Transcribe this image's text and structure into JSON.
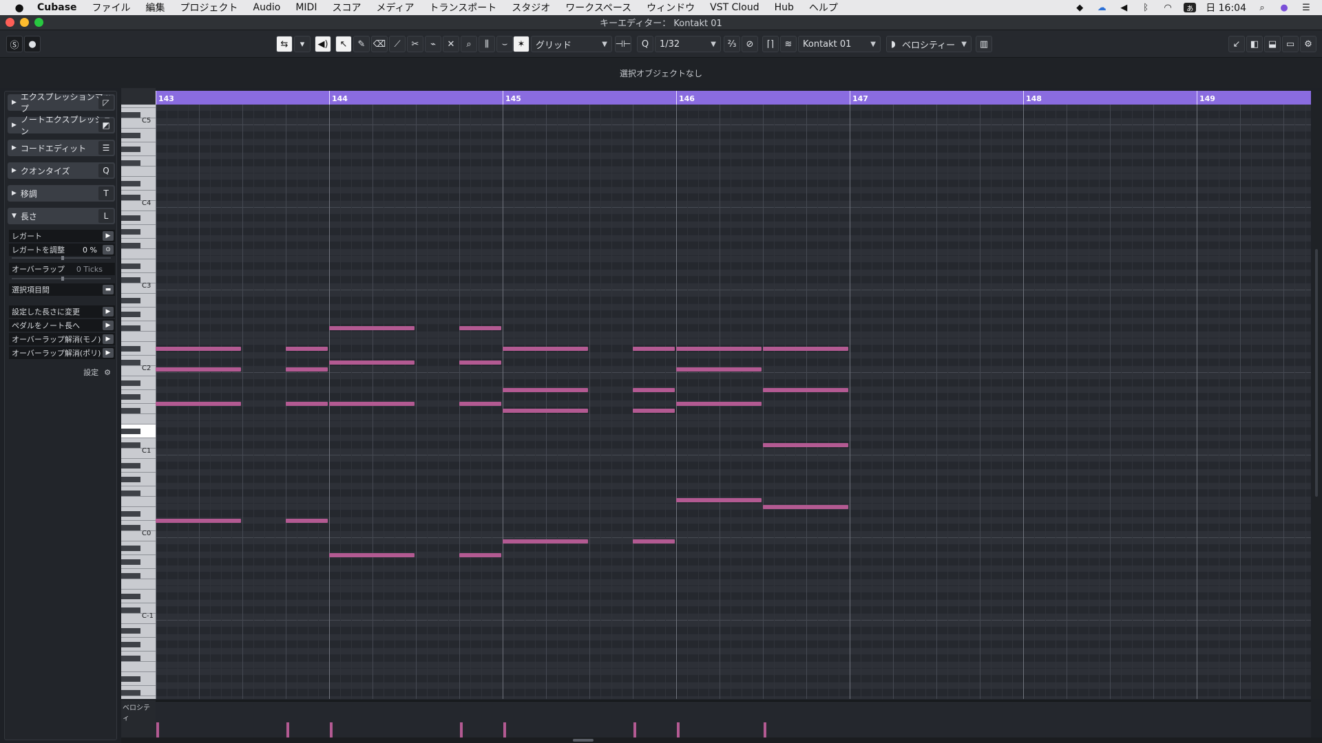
{
  "menubar": {
    "app": "Cubase",
    "items": [
      "ファイル",
      "編集",
      "プロジェクト",
      "Audio",
      "MIDI",
      "スコア",
      "メディア",
      "トランスポート",
      "スタジオ",
      "ワークスペース",
      "ウィンドウ",
      "VST Cloud",
      "Hub",
      "ヘルプ"
    ],
    "clock": "日 16:04"
  },
  "window": {
    "title": "キーエディター： Kontakt 01"
  },
  "toolbar": {
    "snap_type": "グリッド",
    "quantize": "1/32",
    "track": "Kontakt 01",
    "controller": "ベロシティー"
  },
  "infoline": {
    "text": "選択オブジェクトなし"
  },
  "inspector": {
    "sections": [
      {
        "label": "エクスプレッションマップ",
        "icon": "expression-map-icon"
      },
      {
        "label": "ノートエクスプレッション",
        "icon": "note-expression-icon"
      },
      {
        "label": "コードエディット",
        "icon": "chord-edit-icon"
      },
      {
        "label": "クオンタイズ",
        "icon": "quantize-icon",
        "letter": "Q"
      },
      {
        "label": "移調",
        "icon": "transpose-icon",
        "letter": "T"
      },
      {
        "label": "長さ",
        "icon": "length-icon",
        "letter": "L",
        "expanded": true
      }
    ],
    "length": {
      "legato": "レガート",
      "adjust_legato": "レガートを調整",
      "adjust_legato_value": "0 %",
      "overlap": "オーバーラップ",
      "overlap_value": "0 Ticks",
      "between_selected": "選択項目間",
      "fixed_length": "設定した長さに変更",
      "pedal_to_length": "ペダルをノート長へ",
      "delete_overlaps_mono": "オーバーラップ解消(モノ)",
      "delete_overlaps_poly": "オーバーラップ解消(ポリ)"
    },
    "settings_label": "設定"
  },
  "ruler": {
    "bars": [
      "143",
      "144",
      "145",
      "146",
      "147",
      "148",
      "149"
    ]
  },
  "keyboard": {
    "labels": [
      "C5",
      "C4",
      "C3",
      "C2",
      "C1",
      "C0",
      "C-1"
    ]
  },
  "velocity": {
    "label": "ベロシティ"
  },
  "colors": {
    "ruler": "#8a6ce0",
    "note": "#b35a92"
  },
  "notes": [
    {
      "start": 143.0,
      "end": 143.5,
      "pitch": 51
    },
    {
      "start": 143.0,
      "end": 143.5,
      "pitch": 48
    },
    {
      "start": 143.0,
      "end": 143.5,
      "pitch": 43
    },
    {
      "start": 143.0,
      "end": 143.5,
      "pitch": 26
    },
    {
      "start": 143.75,
      "end": 144.0,
      "pitch": 51
    },
    {
      "start": 143.75,
      "end": 144.0,
      "pitch": 48
    },
    {
      "start": 143.75,
      "end": 144.0,
      "pitch": 43
    },
    {
      "start": 143.75,
      "end": 144.0,
      "pitch": 26
    },
    {
      "start": 144.0,
      "end": 144.5,
      "pitch": 54
    },
    {
      "start": 144.0,
      "end": 144.5,
      "pitch": 49
    },
    {
      "start": 144.0,
      "end": 144.5,
      "pitch": 43
    },
    {
      "start": 144.0,
      "end": 144.5,
      "pitch": 21
    },
    {
      "start": 144.75,
      "end": 145.0,
      "pitch": 54
    },
    {
      "start": 144.75,
      "end": 145.0,
      "pitch": 49
    },
    {
      "start": 144.75,
      "end": 145.0,
      "pitch": 43
    },
    {
      "start": 144.75,
      "end": 145.0,
      "pitch": 21
    },
    {
      "start": 145.0,
      "end": 145.5,
      "pitch": 51
    },
    {
      "start": 145.0,
      "end": 145.5,
      "pitch": 45
    },
    {
      "start": 145.0,
      "end": 145.5,
      "pitch": 42
    },
    {
      "start": 145.0,
      "end": 145.5,
      "pitch": 23
    },
    {
      "start": 145.75,
      "end": 146.0,
      "pitch": 51
    },
    {
      "start": 145.75,
      "end": 146.0,
      "pitch": 45
    },
    {
      "start": 145.75,
      "end": 146.0,
      "pitch": 42
    },
    {
      "start": 145.75,
      "end": 146.0,
      "pitch": 23
    },
    {
      "start": 146.0,
      "end": 146.5,
      "pitch": 51
    },
    {
      "start": 146.0,
      "end": 146.5,
      "pitch": 48
    },
    {
      "start": 146.0,
      "end": 146.5,
      "pitch": 43
    },
    {
      "start": 146.0,
      "end": 146.5,
      "pitch": 29
    },
    {
      "start": 146.5,
      "end": 147.0,
      "pitch": 51
    },
    {
      "start": 146.5,
      "end": 147.0,
      "pitch": 45
    },
    {
      "start": 146.5,
      "end": 147.0,
      "pitch": 37
    },
    {
      "start": 146.5,
      "end": 147.0,
      "pitch": 28
    }
  ]
}
